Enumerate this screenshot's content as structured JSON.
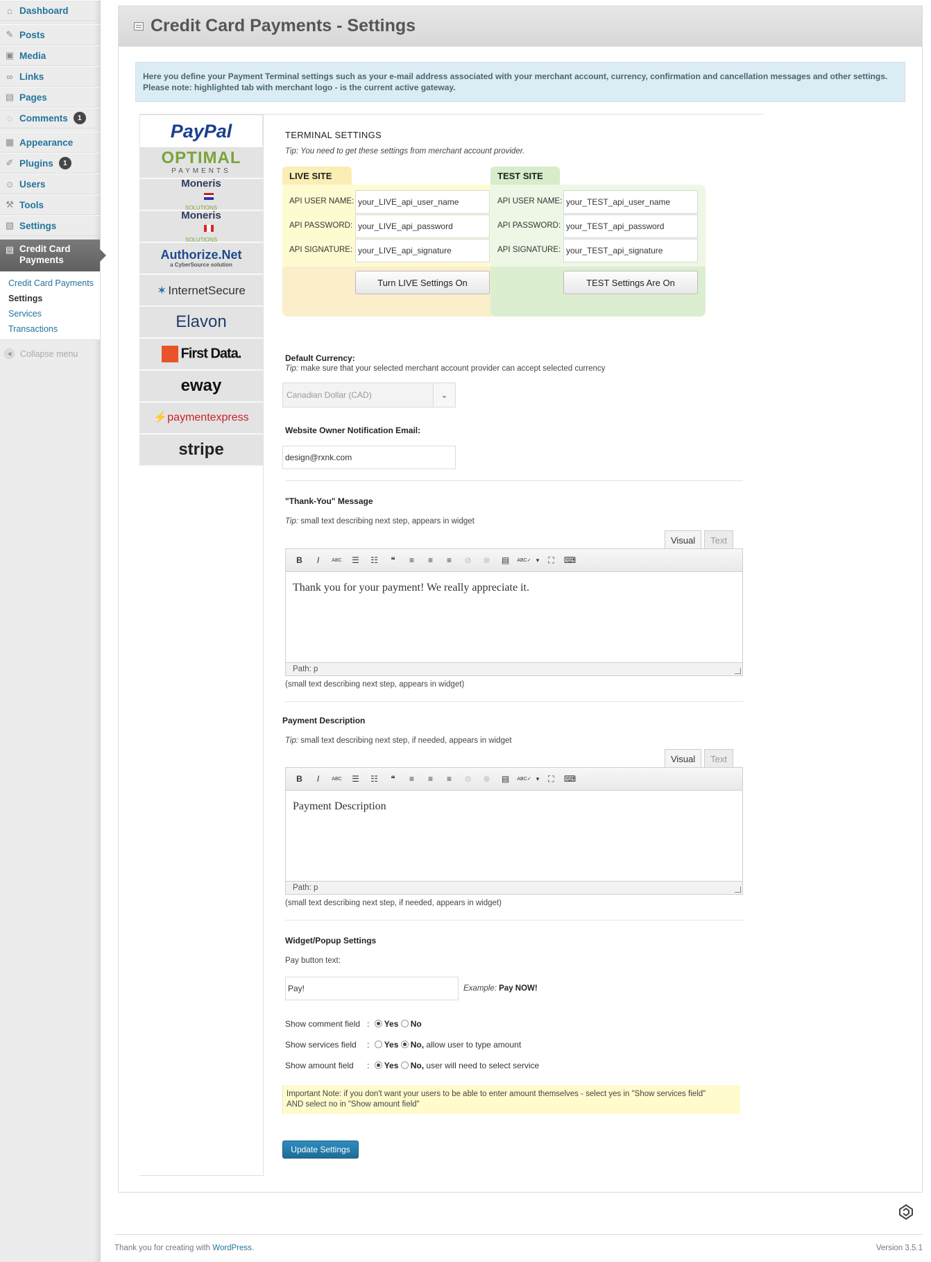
{
  "sidebar": {
    "items": [
      {
        "label": "Dashboard",
        "icon": "dashboard-icon",
        "glyph": "⌂"
      },
      {
        "label": "Posts",
        "icon": "pin-icon",
        "glyph": "✎"
      },
      {
        "label": "Media",
        "icon": "media-icon",
        "glyph": "▣"
      },
      {
        "label": "Links",
        "icon": "link-icon",
        "glyph": "∞"
      },
      {
        "label": "Pages",
        "icon": "pages-icon",
        "glyph": "▤"
      },
      {
        "label": "Comments",
        "icon": "comments-icon",
        "glyph": "◌",
        "badge": "1"
      },
      {
        "label": "Appearance",
        "icon": "appearance-icon",
        "glyph": "▦"
      },
      {
        "label": "Plugins",
        "icon": "plugins-icon",
        "glyph": "✐",
        "badge": "1"
      },
      {
        "label": "Users",
        "icon": "users-icon",
        "glyph": "☺"
      },
      {
        "label": "Tools",
        "icon": "tools-icon",
        "glyph": "⚒"
      },
      {
        "label": "Settings",
        "icon": "settings-icon",
        "glyph": "▧"
      }
    ],
    "active": {
      "label_line1": "Credit Card",
      "label_line2": "Payments",
      "icon": "credit-card-icon",
      "glyph": "▤"
    },
    "submenu": [
      "Credit Card Payments",
      "Settings",
      "Services",
      "Transactions"
    ],
    "collapse": "Collapse menu"
  },
  "page": {
    "title": "Credit Card Payments - Settings",
    "notice_line1": "Here you define your Payment Terminal settings such as your e-mail address associated with your merchant account, currency, confirmation and cancellation messages and other settings.",
    "notice_line2": "Please note: highlighted tab with merchant logo - is the current active gateway."
  },
  "gateways": [
    {
      "name": "PayPal",
      "active": true
    },
    {
      "name": "OPTIMAL",
      "sub": "PAYMENTS"
    },
    {
      "name": "Moneris",
      "sub": "SOLUTIONS",
      "flag": "us"
    },
    {
      "name": "Moneris",
      "sub": "SOLUTIONS",
      "flag": "ca"
    },
    {
      "name": "Authorize.Net",
      "sub": "a CyberSource solution"
    },
    {
      "name": "InternetSecure"
    },
    {
      "name": "Elavon"
    },
    {
      "name": "First Data."
    },
    {
      "name": "eway"
    },
    {
      "name": "paymentexpress"
    },
    {
      "name": "stripe"
    }
  ],
  "terminal": {
    "heading": "TERMINAL SETTINGS",
    "tip_prefix": "Tip:",
    "tip": "You need to get these settings from merchant account provider.",
    "live": {
      "tab": "LIVE SITE",
      "user_label": "API USER NAME:",
      "user_value": "your_LIVE_api_user_name",
      "pass_label": "API PASSWORD:",
      "pass_value": "your_LIVE_api_password",
      "sig_label": "API SIGNATURE:",
      "sig_value": "your_LIVE_api_signature",
      "button": "Turn LIVE Settings On",
      "tab_color": "#fbeeb4",
      "body_color": "#fffbd1",
      "foot_color": "#fbeecb"
    },
    "test": {
      "tab": "TEST SITE",
      "user_label": "API USER NAME:",
      "user_value": "your_TEST_api_user_name",
      "pass_label": "API PASSWORD:",
      "pass_value": "your_TEST_api_password",
      "sig_label": "API SIGNATURE:",
      "sig_value": "your_TEST_api_signature",
      "button": "TEST Settings Are On",
      "tab_color": "#d7ecc8",
      "body_color": "#eef7e6",
      "foot_color": "#dceed0"
    }
  },
  "currency": {
    "label": "Default Currency:",
    "tip_prefix": "Tip:",
    "tip": "make sure that your selected merchant account provider can accept selected currency",
    "value": "Canadian Dollar (CAD)"
  },
  "email": {
    "label": "Website Owner Notification Email:",
    "value": "design@rxnk.com"
  },
  "thankyou": {
    "label": "\"Thank-You\" Message",
    "tip_prefix": "Tip:",
    "tip": "small text describing next step, appears in widget",
    "content": "Thank you for your payment! We really appreciate it.",
    "path": "Path: p",
    "note": "(small text describing next step, appears in widget)"
  },
  "description": {
    "label": "Payment Description",
    "tip_prefix": "Tip:",
    "tip": "small text describing next step, if needed, appears in widget",
    "content": "Payment Description",
    "path": "Path: p",
    "note": "(small text describing next step, if needed, appears in widget)"
  },
  "editor": {
    "visual": "Visual",
    "text": "Text",
    "tools": [
      "B",
      "I",
      "ABC",
      "☰",
      "☷",
      "❝",
      "≡",
      "≡",
      "≡",
      "⊘",
      "⊗",
      "▤",
      "ABC✓",
      "▾",
      "⛶",
      "⌨"
    ]
  },
  "widget": {
    "label": "Widget/Popup Settings",
    "pay_label": "Pay button text:",
    "pay_value": "Pay!",
    "example_prefix": "Example:",
    "example": "Pay NOW!",
    "comment_label": "Show comment field",
    "services_label": "Show services field",
    "amount_label": "Show amount field",
    "colon": ":",
    "yes": "Yes",
    "no": "No",
    "no_services": "No,",
    "no_services_rest": "allow user to type amount",
    "no_amount": "No,",
    "no_amount_rest": "user will need to select service",
    "important_line1": "Important Note: if you don't want your users to be able to enter amount themselves - select yes in \"Show services field\"",
    "important_line2": "AND select no in \"Show amount field\"",
    "button": "Update Settings"
  },
  "footer": {
    "text": "Thank you for creating with ",
    "link": "WordPress",
    "dot": ".",
    "version": "Version 3.5.1"
  }
}
